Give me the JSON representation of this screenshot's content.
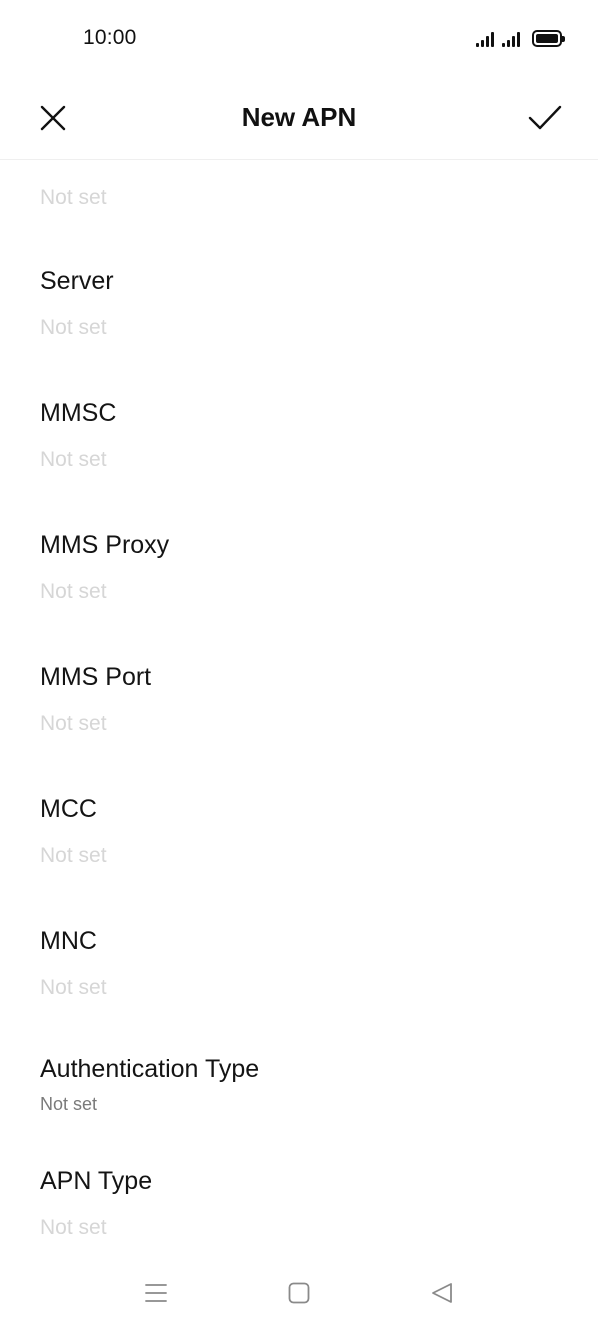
{
  "status_bar": {
    "time": "10:00",
    "icons": [
      "signal-icon",
      "signal-icon",
      "battery-icon"
    ]
  },
  "header": {
    "title": "New APN",
    "close_icon": "close-icon",
    "confirm_icon": "check-icon"
  },
  "fields": [
    {
      "label": "",
      "value": "Not set"
    },
    {
      "label": "Server",
      "value": "Not set"
    },
    {
      "label": "MMSC",
      "value": "Not set"
    },
    {
      "label": "MMS Proxy",
      "value": "Not set"
    },
    {
      "label": "MMS Port",
      "value": "Not set"
    },
    {
      "label": "MCC",
      "value": "Not set"
    },
    {
      "label": "MNC",
      "value": "Not set"
    },
    {
      "label": "Authentication Type",
      "value": "Not set"
    },
    {
      "label": "APN Type",
      "value": "Not set"
    }
  ],
  "nav_bar": {
    "icons": [
      "menu-icon",
      "home-icon",
      "back-icon"
    ]
  },
  "colors": {
    "text": "#111111",
    "placeholder": "#d6d6d6",
    "value_active": "#7a7a7a",
    "divider": "#efefef"
  }
}
